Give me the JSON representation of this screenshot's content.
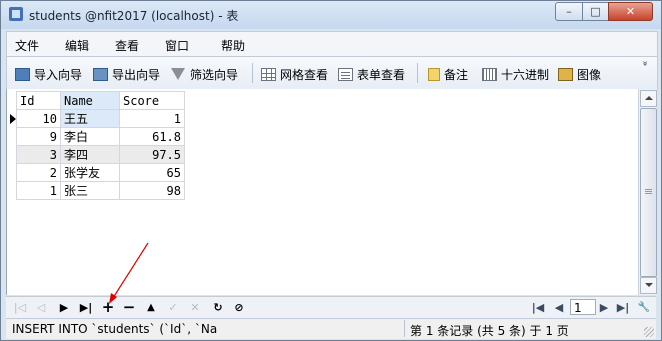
{
  "window": {
    "title": "students @nfit2017 (localhost) - 表",
    "min_label": "–",
    "max_label": "□",
    "close_label": "✕"
  },
  "menu": [
    "文件",
    "编辑",
    "查看",
    "窗口",
    "帮助"
  ],
  "toolbar": {
    "import_wizard": "导入向导",
    "export_wizard": "导出向导",
    "filter_wizard": "筛选向导",
    "grid_view": "网格查看",
    "form_view": "表单查看",
    "memo": "备注",
    "hex": "十六进制",
    "image": "图像",
    "more": "»"
  },
  "grid": {
    "columns": [
      "Id",
      "Name",
      "Score"
    ],
    "rows": [
      {
        "id": "10",
        "name": "王五",
        "score": "1"
      },
      {
        "id": "9",
        "name": "李白",
        "score": "61.8"
      },
      {
        "id": "3",
        "name": "李四",
        "score": "97.5"
      },
      {
        "id": "2",
        "name": "张学友",
        "score": "65"
      },
      {
        "id": "1",
        "name": "张三",
        "score": "98"
      }
    ],
    "current_row": 0
  },
  "nav": {
    "first": "|◁",
    "prev": "◁",
    "next": "▶",
    "last": "▶|",
    "add": "+",
    "delete": "−",
    "up": "▲",
    "apply": "✓",
    "cancel": "✕",
    "refresh": "↻",
    "stop": "⊘",
    "page_first": "|◀",
    "page_prev": "◀",
    "page_value": "1",
    "page_next": "▶",
    "page_last": "▶|",
    "settings": "🔧"
  },
  "status": {
    "sql": "INSERT INTO `students` (`Id`, `Na",
    "record_info": "第 1 条记录 (共 5 条) 于 1 页"
  },
  "colors": {
    "annotation": "#e00000",
    "header_highlight": "#dce9f8",
    "alt_row": "#ebebeb"
  }
}
